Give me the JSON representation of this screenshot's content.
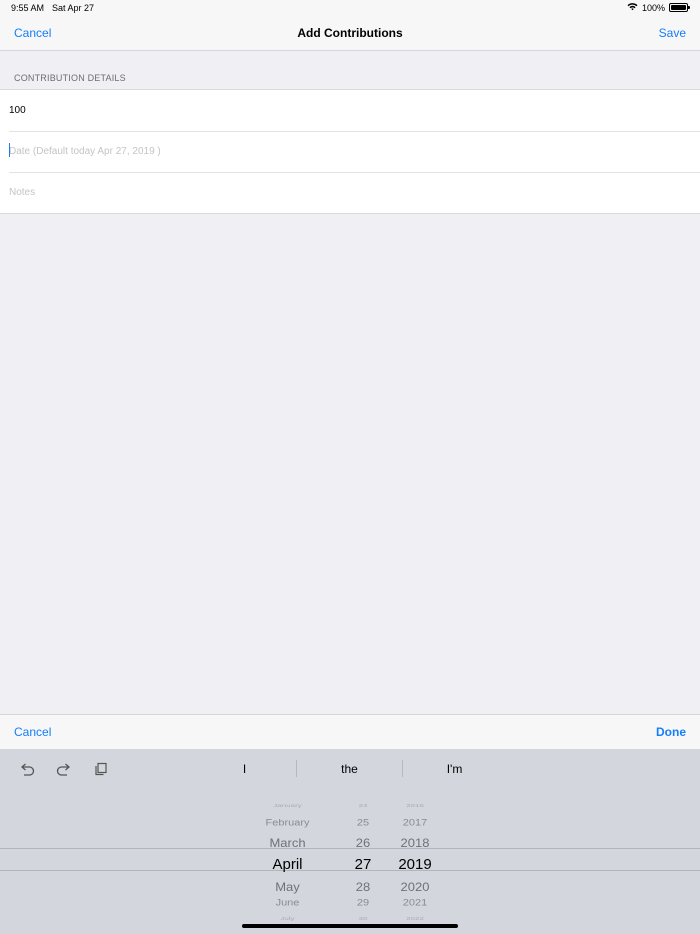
{
  "status": {
    "time": "9:55 AM",
    "date": "Sat Apr 27",
    "battery": "100%"
  },
  "nav": {
    "cancel": "Cancel",
    "title": "Add Contributions",
    "save": "Save"
  },
  "form": {
    "section_header": "CONTRIBUTION DETAILS",
    "amount_value": "100",
    "date_placeholder": "Date (Default today Apr 27, 2019 )",
    "notes_placeholder": "Notes"
  },
  "toolbar": {
    "cancel": "Cancel",
    "done": "Done"
  },
  "keyboard": {
    "shortcut_icons": [
      "undo-icon",
      "redo-icon",
      "paste-icon"
    ],
    "predictions": [
      "I",
      "the",
      "I'm"
    ]
  },
  "picker": {
    "months": [
      "January",
      "February",
      "March",
      "April",
      "May",
      "June",
      "July"
    ],
    "days": [
      "24",
      "25",
      "26",
      "27",
      "28",
      "29",
      "30"
    ],
    "years": [
      "2016",
      "2017",
      "2018",
      "2019",
      "2020",
      "2021",
      "2022"
    ],
    "selected": {
      "month": "April",
      "day": "27",
      "year": "2019"
    }
  }
}
